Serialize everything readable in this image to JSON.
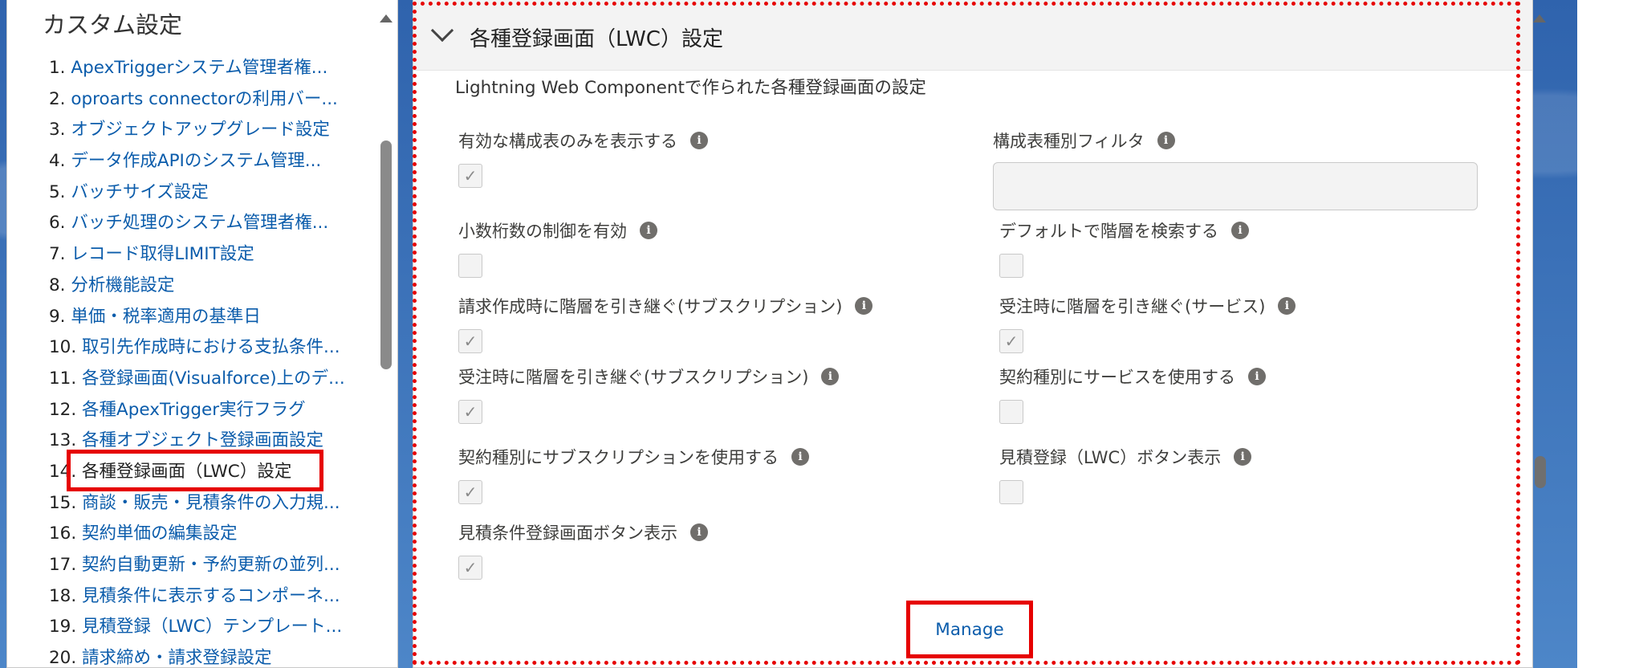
{
  "sidebar": {
    "title": "カスタム設定",
    "items": [
      {
        "num": "1.",
        "label": "ApexTriggerシステム管理者権..."
      },
      {
        "num": "2.",
        "label": "oproarts connectorの利用バー..."
      },
      {
        "num": "3.",
        "label": "オブジェクトアップグレード設定"
      },
      {
        "num": "4.",
        "label": "データ作成APIのシステム管理..."
      },
      {
        "num": "5.",
        "label": "バッチサイズ設定"
      },
      {
        "num": "6.",
        "label": "バッチ処理のシステム管理者権..."
      },
      {
        "num": "7.",
        "label": "レコード取得LIMIT設定"
      },
      {
        "num": "8.",
        "label": "分析機能設定"
      },
      {
        "num": "9.",
        "label": "単価・税率適用の基準日"
      },
      {
        "num": "10.",
        "label": "取引先作成時における支払条件..."
      },
      {
        "num": "11.",
        "label": "各登録画面(Visualforce)上のデ..."
      },
      {
        "num": "12.",
        "label": "各種ApexTrigger実行フラグ"
      },
      {
        "num": "13.",
        "label": "各種オブジェクト登録画面設定"
      },
      {
        "num": "14.",
        "label": "各種登録画面（LWC）設定"
      },
      {
        "num": "15.",
        "label": "商談・販売・見積条件の入力規..."
      },
      {
        "num": "16.",
        "label": "契約単価の編集設定"
      },
      {
        "num": "17.",
        "label": "契約自動更新・予約更新の並列..."
      },
      {
        "num": "18.",
        "label": "見積条件に表示するコンポーネ..."
      },
      {
        "num": "19.",
        "label": "見積登録（LWC）テンプレート..."
      },
      {
        "num": "20.",
        "label": "請求締め・請求登録設定"
      }
    ]
  },
  "main": {
    "section_title": "各種登録画面（LWC）設定",
    "description": "Lightning Web Componentで作られた各種登録画面の設定",
    "fields": {
      "f1": {
        "label": "有効な構成表のみを表示する",
        "checked": "✓"
      },
      "f2": {
        "label": "構成表種別フィルタ"
      },
      "f3": {
        "label": "小数桁数の制御を有効",
        "checked": ""
      },
      "f4": {
        "label": "デフォルトで階層を検索する",
        "checked": ""
      },
      "f5": {
        "label": "請求作成時に階層を引き継ぐ(サブスクリプション)",
        "checked": "✓"
      },
      "f6": {
        "label": "受注時に階層を引き継ぐ(サービス)",
        "checked": "✓"
      },
      "f7": {
        "label": "受注時に階層を引き継ぐ(サブスクリプション)",
        "checked": "✓"
      },
      "f8": {
        "label": "契約種別にサービスを使用する",
        "checked": ""
      },
      "f9": {
        "label": "契約種別にサブスクリプションを使用する",
        "checked": "✓"
      },
      "f10": {
        "label": "見積登録（LWC）ボタン表示",
        "checked": ""
      },
      "f11": {
        "label": "見積条件登録画面ボタン表示",
        "checked": "✓"
      }
    },
    "info_glyph": "i",
    "manage_label": "Manage"
  }
}
